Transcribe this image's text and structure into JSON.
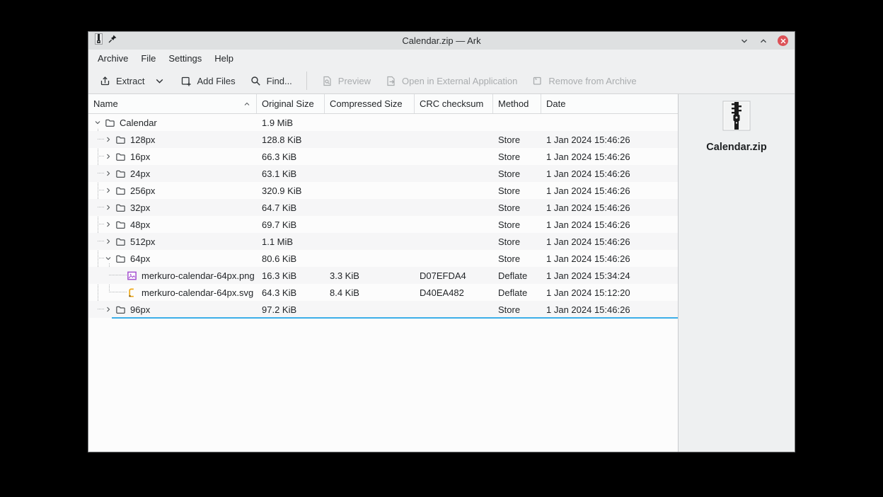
{
  "window": {
    "title": "Calendar.zip — Ark",
    "controls": [
      {
        "name": "minimize-button",
        "icon": "chevron-down-icon"
      },
      {
        "name": "maximize-button",
        "icon": "chevron-up-icon"
      },
      {
        "name": "close-button",
        "icon": "close-icon"
      }
    ]
  },
  "menubar": {
    "items": [
      {
        "label": "Archive"
      },
      {
        "label": "File"
      },
      {
        "label": "Settings"
      },
      {
        "label": "Help"
      }
    ]
  },
  "toolbar": {
    "buttons": [
      {
        "label": "Extract",
        "icon": "extract-icon",
        "enabled": true,
        "dropdown": true
      },
      {
        "label": "Add Files",
        "icon": "add-files-icon",
        "enabled": true
      },
      {
        "label": "Find...",
        "icon": "search-icon",
        "enabled": true,
        "separator_after": true
      },
      {
        "label": "Preview",
        "icon": "preview-icon",
        "enabled": false
      },
      {
        "label": "Open in External Application",
        "icon": "open-external-icon",
        "enabled": false
      },
      {
        "label": "Remove from Archive",
        "icon": "remove-from-archive-icon",
        "enabled": false
      }
    ]
  },
  "archive_view": {
    "columns": [
      {
        "label": "Name",
        "sorted": "ascending"
      },
      {
        "label": "Original Size"
      },
      {
        "label": "Compressed Size"
      },
      {
        "label": "CRC checksum"
      },
      {
        "label": "Method"
      },
      {
        "label": "Date"
      }
    ],
    "rows": [
      {
        "name": "Calendar",
        "depth": 0,
        "kind": "folder",
        "expanded": true,
        "original_size": "1.9 MiB",
        "compressed_size": "",
        "crc_checksum": "",
        "method": "",
        "date": ""
      },
      {
        "name": "128px",
        "depth": 1,
        "kind": "folder",
        "expanded": false,
        "original_size": "128.8 KiB",
        "compressed_size": "",
        "crc_checksum": "",
        "method": "Store",
        "date": "1 Jan 2024 15:46:26"
      },
      {
        "name": "16px",
        "depth": 1,
        "kind": "folder",
        "expanded": false,
        "original_size": "66.3 KiB",
        "compressed_size": "",
        "crc_checksum": "",
        "method": "Store",
        "date": "1 Jan 2024 15:46:26"
      },
      {
        "name": "24px",
        "depth": 1,
        "kind": "folder",
        "expanded": false,
        "original_size": "63.1 KiB",
        "compressed_size": "",
        "crc_checksum": "",
        "method": "Store",
        "date": "1 Jan 2024 15:46:26"
      },
      {
        "name": "256px",
        "depth": 1,
        "kind": "folder",
        "expanded": false,
        "original_size": "320.9 KiB",
        "compressed_size": "",
        "crc_checksum": "",
        "method": "Store",
        "date": "1 Jan 2024 15:46:26"
      },
      {
        "name": "32px",
        "depth": 1,
        "kind": "folder",
        "expanded": false,
        "original_size": "64.7 KiB",
        "compressed_size": "",
        "crc_checksum": "",
        "method": "Store",
        "date": "1 Jan 2024 15:46:26"
      },
      {
        "name": "48px",
        "depth": 1,
        "kind": "folder",
        "expanded": false,
        "original_size": "69.7 KiB",
        "compressed_size": "",
        "crc_checksum": "",
        "method": "Store",
        "date": "1 Jan 2024 15:46:26"
      },
      {
        "name": "512px",
        "depth": 1,
        "kind": "folder",
        "expanded": false,
        "original_size": "1.1 MiB",
        "compressed_size": "",
        "crc_checksum": "",
        "method": "Store",
        "date": "1 Jan 2024 15:46:26"
      },
      {
        "name": "64px",
        "depth": 1,
        "kind": "folder",
        "expanded": true,
        "original_size": "80.6 KiB",
        "compressed_size": "",
        "crc_checksum": "",
        "method": "Store",
        "date": "1 Jan 2024 15:46:26"
      },
      {
        "name": "merkuro-calendar-64px.png",
        "depth": 2,
        "kind": "image-file",
        "expanded": null,
        "original_size": "16.3 KiB",
        "compressed_size": "3.3 KiB",
        "crc_checksum": "D07EFDA4",
        "method": "Deflate",
        "date": "1 Jan 2024 15:34:24"
      },
      {
        "name": "merkuro-calendar-64px.svg",
        "depth": 2,
        "kind": "vector-file",
        "expanded": null,
        "original_size": "64.3 KiB",
        "compressed_size": "8.4 KiB",
        "crc_checksum": "D40EA482",
        "method": "Deflate",
        "date": "1 Jan 2024 15:12:20"
      },
      {
        "name": "96px",
        "depth": 1,
        "kind": "folder",
        "expanded": false,
        "original_size": "97.2 KiB",
        "compressed_size": "",
        "crc_checksum": "",
        "method": "Store",
        "date": "1 Jan 2024 15:46:26",
        "focused": true
      }
    ]
  },
  "side_panel": {
    "file_name": "Calendar.zip",
    "icon": "zip-file-icon"
  },
  "colors": {
    "accent": "#3daee9",
    "close_button": "#dc5157",
    "png_icon": "#a44fd0",
    "svg_icon": "#f0a817"
  }
}
